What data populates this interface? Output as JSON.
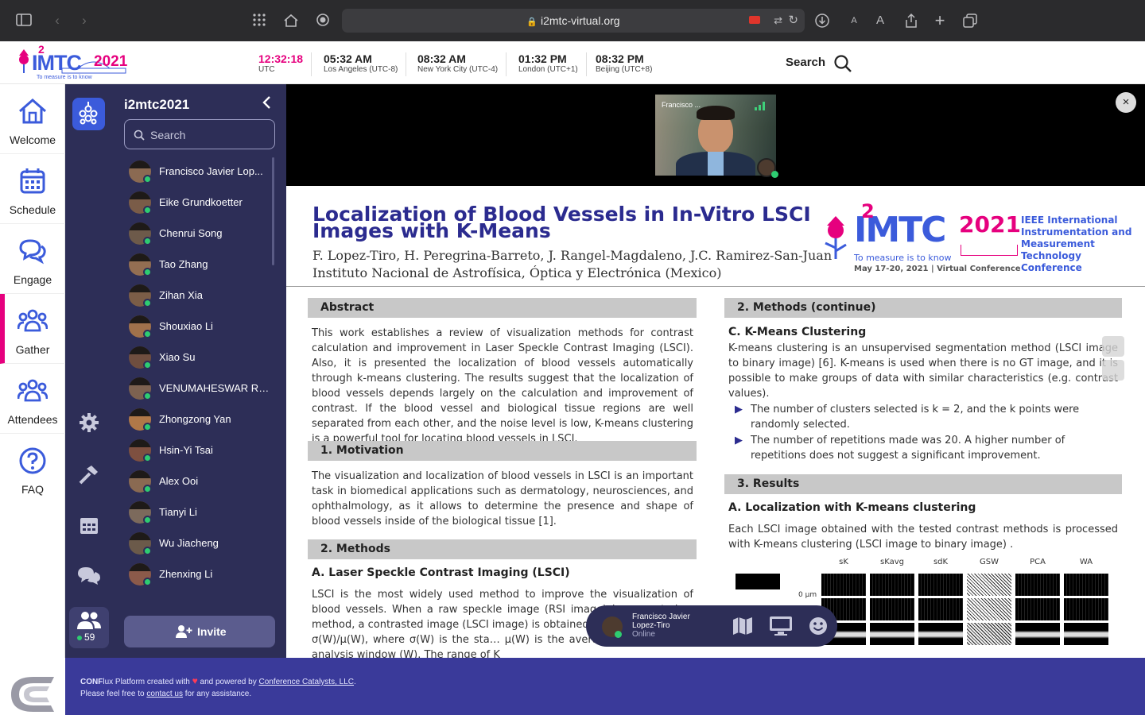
{
  "browser": {
    "url": "i2mtc-virtual.org",
    "font_small": "A",
    "font_large": "A"
  },
  "header": {
    "logo_text": "I²MTC 2021",
    "logo_tagline": "To measure is to know",
    "times": [
      {
        "time": "12:32:18",
        "zone": "UTC",
        "accent": true
      },
      {
        "time": "05:32 AM",
        "zone": "Los Angeles (UTC-8)"
      },
      {
        "time": "08:32 AM",
        "zone": "New York City (UTC-4)"
      },
      {
        "time": "01:32 PM",
        "zone": "London (UTC+1)"
      },
      {
        "time": "08:32 PM",
        "zone": "Beijing (UTC+8)"
      }
    ],
    "search_label": "Search"
  },
  "leftnav": [
    {
      "label": "Welcome",
      "icon": "home-icon"
    },
    {
      "label": "Schedule",
      "icon": "calendar-icon"
    },
    {
      "label": "Engage",
      "icon": "chat-bubbles-icon"
    },
    {
      "label": "Gather",
      "icon": "group-icon",
      "active": true
    },
    {
      "label": "Attendees",
      "icon": "attendees-icon"
    },
    {
      "label": "FAQ",
      "icon": "question-icon"
    }
  ],
  "panel": {
    "title": "i2mtc2021",
    "search_placeholder": "Search",
    "invite_label": "Invite",
    "online_count": "59",
    "people": [
      "Francisco Javier Lop...",
      "Eike Grundkoetter",
      "Chenrui Song",
      "Tao Zhang",
      "Zihan Xia",
      "Shouxiao Li",
      "Xiao Su",
      "VENUMAHESWAR RA...",
      "Zhongzong Yan",
      "Hsin-Yi Tsai",
      "Alex Ooi",
      "Tianyi Li",
      "Wu Jiacheng",
      "Zhenxing Li"
    ]
  },
  "video": {
    "speaker_label": "Francisco ..."
  },
  "poster": {
    "title_line1": "Localization of Blood Vessels in In-Vitro LSCI",
    "title_line2": "Images with K-Means",
    "authors": "F. Lopez-Tiro, H. Peregrina-Barreto, J. Rangel-Magdaleno, J.C. Ramirez-San-Juan",
    "institution": "Instituto Nacional de Astrofísica, Óptica y Electrónica (Mexico)",
    "conf_name": "IEEE International Instrumentation and Measurement Technology Conference",
    "conf_dates": "May 17-20, 2021 | Virtual Conference",
    "abstract_head": "Abstract",
    "abstract": "This work establishes a review of visualization methods for contrast calculation and improvement in Laser Speckle Contrast Imaging (LSCI). Also, it is presented the localization of blood vessels automatically through k-means clustering. The results suggest that the localization of blood vessels depends largely on the calculation and improvement of contrast. If the blood vessel and biological tissue regions are well separated from each other, and the noise level is low, K-means clustering is a powerful tool for locating blood vessels in LSCI.",
    "motivation_head": "1.  Motivation",
    "motivation": "The visualization and localization of blood vessels in LSCI is an important task in biomedical applications such as dermatology, neurosciences, and ophthalmology, as it allows to determine the presence and shape of blood vessels inside of the biological tissue [1].",
    "methods_head": "2.  Methods",
    "methods_sub": "A.  Laser Speckle Contrast Imaging (LSCI)",
    "methods_text": "LSCI is the most widely used method to improve the visualization of blood vessels. When a raw speckle image (RSI image) is computed … method, a contrasted image (LSCI image) is obtained … is defined as K = σ(W)/μ(W), where σ(W) is the sta… μ(W) is the average intensity of an analysis window (W). The range of K",
    "methods_cont_head": "2.  Methods (continue)",
    "kmeans_sub": "C.  K-Means Clustering",
    "kmeans_text": "K-means clustering is an unsupervised segmentation method (LSCI image to binary image) [6]. K-means is used when there is no GT image, and it is possible to make groups of data with similar characteristics (e.g. contrast values).",
    "bullets": [
      "The number of clusters selected is k = 2, and the k points were randomly selected.",
      "The number of repetitions made was 20. A higher number of repetitions does not suggest a significant improvement."
    ],
    "results_head": "3.  Results",
    "results_sub": "A.  Localization with K-means clustering",
    "results_text": "Each LSCI image obtained with the tested contrast methods is processed with K-means clustering (LSCI image to binary image) .",
    "fig_cols": [
      "sK",
      "sKavg",
      "sdK",
      "GSW",
      "PCA",
      "WA"
    ],
    "fig_row_label": "0 μm"
  },
  "callbar": {
    "name_line1": "Francisco Javier",
    "name_line2": "Lopez-Tiro",
    "status": "Online"
  },
  "footer": {
    "brand": "CONF",
    "line1_a": "lux Platform created with",
    "line1_b": "and powered by",
    "link1": "Conference Catalysts, LLC",
    "line2_a": "Please feel free to",
    "link2": "contact us",
    "line2_b": "for any assistance."
  },
  "colors": {
    "accent": "#e6007e",
    "panel": "#2d2e57",
    "footer": "#3a3a9a",
    "poster_title": "#2b2b8f",
    "brand_blue": "#3b5bdb"
  }
}
